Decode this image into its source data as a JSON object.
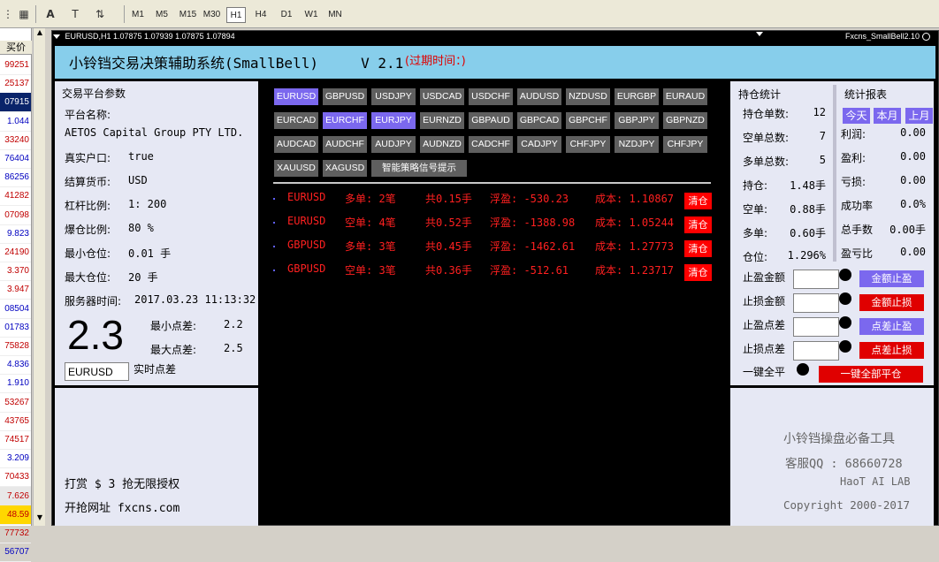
{
  "toolbar": {
    "timeframes": [
      "M1",
      "M5",
      "M15",
      "M30",
      "H1",
      "H4",
      "D1",
      "W1",
      "MN"
    ],
    "active_timeframe": "H1"
  },
  "price_column": {
    "header": "买价",
    "values": [
      "99251",
      "25137",
      "07915",
      "1.044",
      "33240",
      "76404",
      "86256",
      "41282",
      "07098",
      "9.823",
      "24190",
      "3.370",
      "3.947",
      "08504",
      "01783",
      "75828",
      "4.836",
      "1.910",
      "53267",
      "43765",
      "74517",
      "3.209",
      "70433",
      "7.626",
      "48.59",
      "77732",
      "56707"
    ]
  },
  "chart": {
    "title": "EURUSD,H1  1.07875 1.07939 1.07875 1.07894",
    "ea_name": "Fxcns_SmallBell2.10"
  },
  "banner": {
    "title": "小铃铛交易决策辅助系统(SmallBell)     V 2.1",
    "expiry": "(过期时间：)"
  },
  "account": {
    "section_title": "交易平台参数",
    "platform_label": "平台名称:",
    "platform_value": "AETOS Capital Group PTY LTD.",
    "real_label": "真实户口:",
    "real_value": "true",
    "currency_label": "结算货币:",
    "currency_value": "USD",
    "leverage_label": "杠杆比例:",
    "leverage_value": "1: 200",
    "stopout_label": "爆仓比例:",
    "stopout_value": "80 %",
    "minlot_label": "最小仓位:",
    "minlot_value": "0.01 手",
    "maxlot_label": "最大仓位:",
    "maxlot_value": "20 手",
    "server_time_label": "服务器时间:",
    "server_time_value": "2017.03.23 11:13:32",
    "spread_big": "2.3",
    "min_spread_label": "最小点差:",
    "min_spread_value": "2.2",
    "max_spread_label": "最大点差:",
    "max_spread_value": "2.5",
    "symbol_input": "EURUSD",
    "realtime_spread_label": "实时点差"
  },
  "promo": {
    "line1": "打赏 $ 3 抢无限授权",
    "line2": "开抢网址 fxcns.com"
  },
  "symbols": [
    {
      "name": "EURUSD",
      "selected": true
    },
    {
      "name": "GBPUSD",
      "selected": false
    },
    {
      "name": "USDJPY",
      "selected": false
    },
    {
      "name": "USDCAD",
      "selected": false
    },
    {
      "name": "USDCHF",
      "selected": false
    },
    {
      "name": "AUDUSD",
      "selected": false
    },
    {
      "name": "NZDUSD",
      "selected": false
    },
    {
      "name": "EURGBP",
      "selected": false
    },
    {
      "name": "EURAUD",
      "selected": false
    },
    {
      "name": "EURCAD",
      "selected": false
    },
    {
      "name": "EURCHF",
      "selected": true
    },
    {
      "name": "EURJPY",
      "selected": true
    },
    {
      "name": "EURNZD",
      "selected": false
    },
    {
      "name": "GBPAUD",
      "selected": false
    },
    {
      "name": "GBPCAD",
      "selected": false
    },
    {
      "name": "GBPCHF",
      "selected": false
    },
    {
      "name": "GBPJPY",
      "selected": false
    },
    {
      "name": "GBPNZD",
      "selected": false
    },
    {
      "name": "AUDCAD",
      "selected": false
    },
    {
      "name": "AUDCHF",
      "selected": false
    },
    {
      "name": "AUDJPY",
      "selected": false
    },
    {
      "name": "AUDNZD",
      "selected": false
    },
    {
      "name": "CADCHF",
      "selected": false
    },
    {
      "name": "CADJPY",
      "selected": false
    },
    {
      "name": "CHFJPY",
      "selected": false
    },
    {
      "name": "NZDJPY",
      "selected": false
    },
    {
      "name": "CHFJPY",
      "selected": false
    },
    {
      "name": "XAUUSD",
      "selected": false
    },
    {
      "name": "XAGUSD",
      "selected": false
    },
    {
      "name": "智能策略信号提示",
      "selected": false
    }
  ],
  "orders": [
    {
      "symbol": "EURUSD",
      "side": "多单: 2笔",
      "lots": "共0.15手",
      "pnl": "浮盈: -530.23",
      "cost": "成本: 1.10867",
      "clear": "清仓"
    },
    {
      "symbol": "EURUSD",
      "side": "空单: 4笔",
      "lots": "共0.52手",
      "pnl": "浮盈: -1388.98",
      "cost": "成本: 1.05244",
      "clear": "清仓"
    },
    {
      "symbol": "GBPUSD",
      "side": "多单: 3笔",
      "lots": "共0.45手",
      "pnl": "浮盈: -1462.61",
      "cost": "成本: 1.27773",
      "clear": "清仓"
    },
    {
      "symbol": "GBPUSD",
      "side": "空单: 3笔",
      "lots": "共0.36手",
      "pnl": "浮盈: -512.61",
      "cost": "成本: 1.23717",
      "clear": "清仓"
    }
  ],
  "positions": {
    "title": "持仓统计",
    "rows": [
      {
        "label": "持仓单数:",
        "value": "12"
      },
      {
        "label": "空单总数:",
        "value": "7"
      },
      {
        "label": "多单总数:",
        "value": "5"
      },
      {
        "label": "持仓:",
        "value": "1.48手"
      },
      {
        "label": "空单:",
        "value": "0.88手"
      },
      {
        "label": "多单:",
        "value": "0.60手"
      },
      {
        "label": "仓位:",
        "value": "1.296%"
      }
    ]
  },
  "report": {
    "title": "统计报表",
    "tabs": [
      "今天",
      "本月",
      "上月"
    ],
    "rows": [
      {
        "label": "利润:",
        "value": "0.00"
      },
      {
        "label": "盈利:",
        "value": "0.00"
      },
      {
        "label": "亏损:",
        "value": "0.00"
      },
      {
        "label": "成功率",
        "value": "0.0%"
      },
      {
        "label": "总手数",
        "value": "0.00手"
      },
      {
        "label": "盈亏比",
        "value": "0.00"
      }
    ]
  },
  "controls": {
    "tp_amount_label": "止盈金额",
    "sl_amount_label": "止损金额",
    "tp_points_label": "止盈点差",
    "sl_points_label": "止损点差",
    "close_all_label": "一键全平",
    "btn_tp_amount": "金额止盈",
    "btn_sl_amount": "金额止损",
    "btn_tp_points": "点差止盈",
    "btn_sl_points": "点差止损",
    "btn_close_all": "一键全部平仓"
  },
  "footer": {
    "line1": "小铃铛操盘必备工具",
    "line2": "客服QQ : 68660728",
    "line3": "HaoT AI LAB",
    "line4": "Copyright 2000-2017"
  },
  "colors": {
    "banner_bg": "#87ceeb",
    "panel_bg": "#e6e8f4",
    "selected_symbol": "#7b68ee",
    "symbol_btn": "#5f5f5f",
    "order_text": "#ff2020",
    "clear_btn": "#ff0000"
  }
}
